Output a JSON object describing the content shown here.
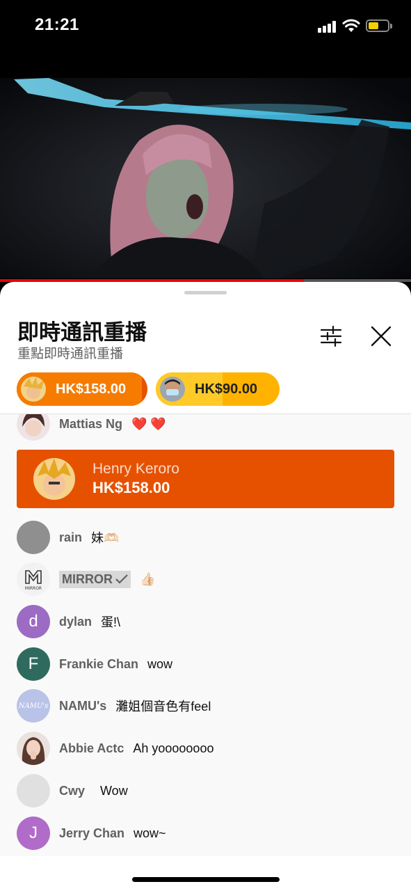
{
  "status": {
    "time": "21:21"
  },
  "video": {
    "progress_percent": 74
  },
  "panel": {
    "title": "即時通訊重播",
    "subtitle": "重點即時通訊重播",
    "icons": {
      "filter": "tune-icon",
      "close": "close-icon"
    }
  },
  "ticker": [
    {
      "amount": "HK$158.00",
      "color": "#e75200"
    },
    {
      "amount": "HK$90.00",
      "color": "#ffb300"
    }
  ],
  "messages": [
    {
      "author": "Mattias Ng",
      "text": "❤️ ❤️"
    },
    {
      "author": "rain",
      "text": "妹🫶🏻"
    },
    {
      "author": "MIRROR",
      "text": "👍🏻"
    },
    {
      "author": "dylan",
      "text": "蛋!\\",
      "initial": "d",
      "color": "#9c6bc4"
    },
    {
      "author": "Frankie Chan",
      "text": "wow",
      "initial": "F",
      "color": "#2e6b5e"
    },
    {
      "author": "NAMU's",
      "text": "灘姐個音色有feel",
      "avatar_text": "NAMU's"
    },
    {
      "author": "Abbie Actc",
      "text": "Ah yoooooooo"
    },
    {
      "author": "Cwy",
      "text": "Wow"
    },
    {
      "author": "Jerry Chan",
      "text": "wow~",
      "initial": "J",
      "color": "#b06cc8"
    }
  ],
  "superchat": {
    "author": "Henry Keroro",
    "amount": "HK$158.00",
    "color": "#e65100"
  },
  "mirror_logo_text": "MIRROR"
}
